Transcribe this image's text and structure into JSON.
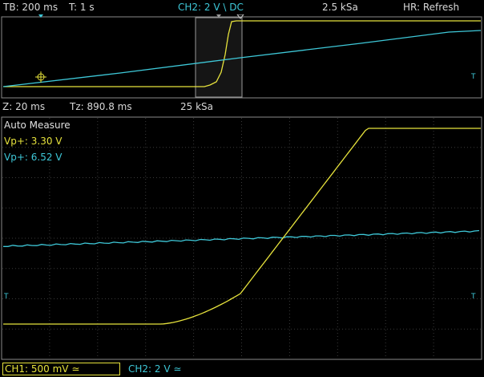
{
  "top_bar": {
    "timebase": "TB: 200 ms",
    "trigger_time": "T: 1 s",
    "ch2_setting": "CH2: 2 V \\ DC",
    "sample_rate": "2.5 kSa",
    "hr_mode": "HR: Refresh"
  },
  "zoom_bar": {
    "zoom": "Z: 20 ms",
    "tz": "Tz: 890.8 ms",
    "sample_rate": "25 kSa"
  },
  "measure": {
    "title": "Auto Measure",
    "items": [
      {
        "label": "Vp+: 3.30 V",
        "color": "#e6e23c"
      },
      {
        "label": "Vp+: 6.52 V",
        "color": "#3ec8d8"
      }
    ]
  },
  "bottom_bar": {
    "ch1": "CH1: 500 mV ≃",
    "ch2": "CH2: 2 V ≃"
  },
  "markers": {
    "trigger_right": "T",
    "trigger_left": "T"
  },
  "colors": {
    "ch1": "#e6e23c",
    "ch2": "#3ec8d8",
    "grid": "#3a3a3a",
    "border": "#8a8a8a"
  }
}
